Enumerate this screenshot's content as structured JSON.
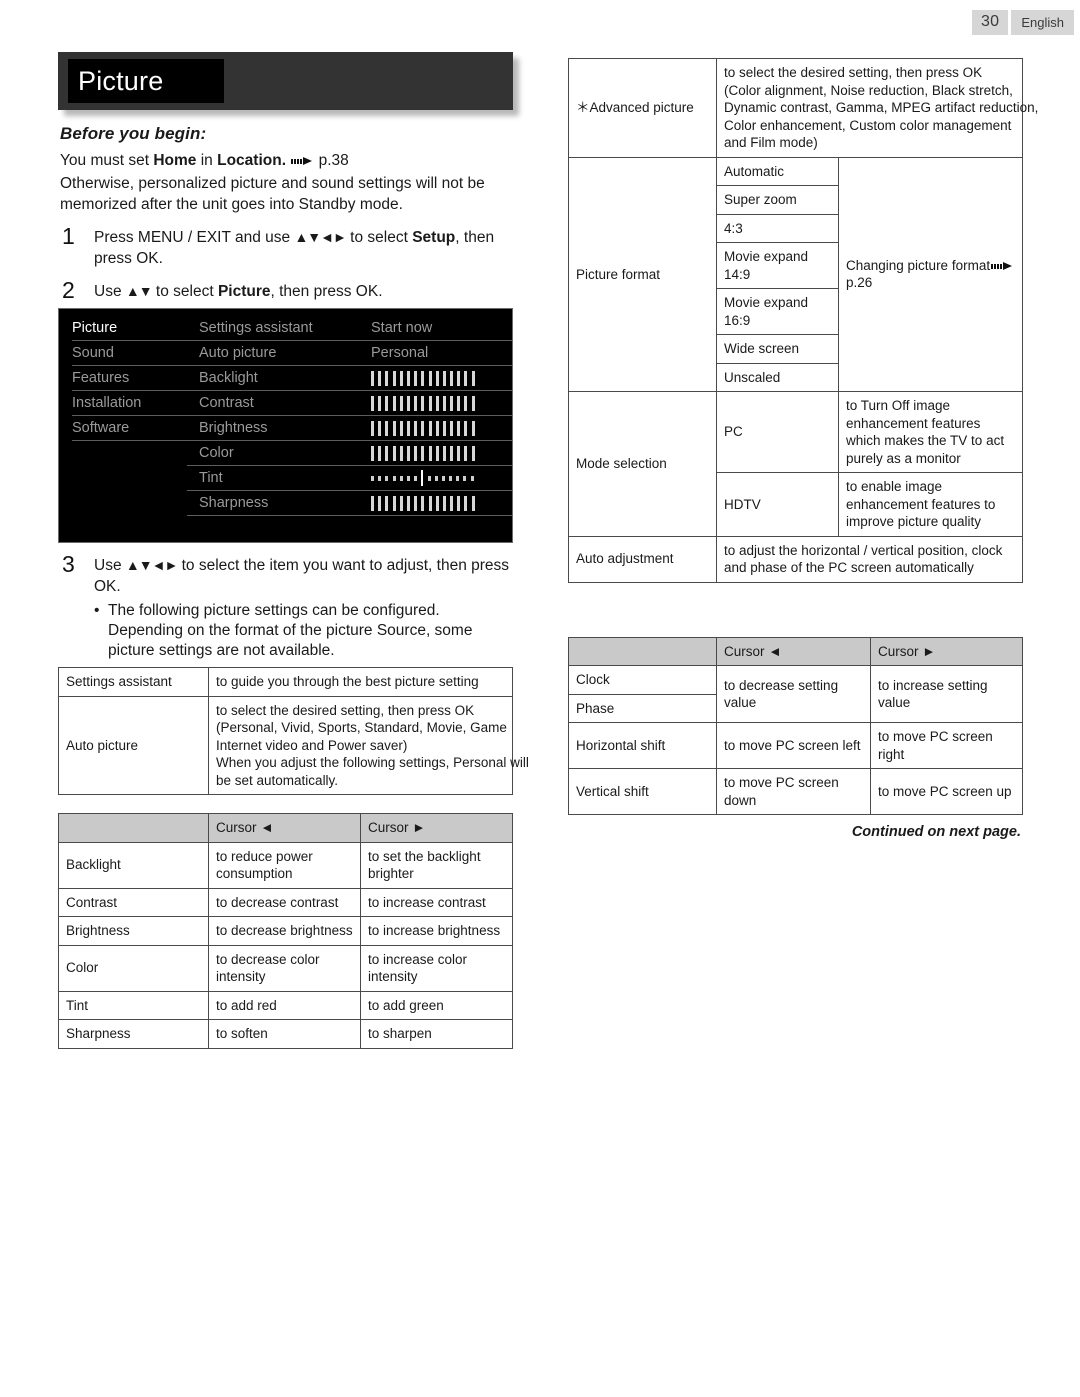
{
  "header": {
    "page_number": "30",
    "language": "English"
  },
  "section": {
    "title": "Picture",
    "before_you_begin_label": "Before you begin:",
    "requirement_prefix": "You must set ",
    "requirement_home": "Home",
    "requirement_mid": " in ",
    "requirement_location": "Location.",
    "requirement_page_ref": "p.38",
    "note": "Otherwise, personalized picture and sound settings will not be memorized after the unit goes into Standby mode."
  },
  "steps": [
    {
      "number": "1",
      "text_1": "Press MENU / EXIT and use ",
      "arrows": "▲▼◄►",
      "text_2": " to select ",
      "bold": "Setup",
      "text_3": ", then press OK."
    },
    {
      "number": "2",
      "text_1": "Use ",
      "arrows": "▲▼",
      "text_2": " to select ",
      "bold": "Picture",
      "text_3": ", then press OK."
    },
    {
      "number": "3",
      "text_1": "Use ",
      "arrows": "▲▼◄►",
      "text_2": " to select the item you want to adjust, then press OK.",
      "bullet": "The following picture settings can be configured. Depending on the format of the picture Source, some picture settings are not available."
    }
  ],
  "osd": {
    "menu_column": [
      {
        "label": "Picture",
        "selected": true
      },
      {
        "label": "Sound",
        "selected": false
      },
      {
        "label": "Features",
        "selected": false
      },
      {
        "label": "Installation",
        "selected": false
      },
      {
        "label": "Software",
        "selected": false
      }
    ],
    "settings_column": [
      "Settings assistant",
      "Auto picture",
      "Backlight",
      "Contrast",
      "Brightness",
      "Color",
      "Tint",
      "Sharpness"
    ],
    "values_column": [
      {
        "type": "text",
        "value": "Start now"
      },
      {
        "type": "text",
        "value": "Personal"
      },
      {
        "type": "bar",
        "ticks": 15,
        "marker": null
      },
      {
        "type": "bar",
        "ticks": 15,
        "marker": null
      },
      {
        "type": "bar",
        "ticks": 15,
        "marker": null
      },
      {
        "type": "bar",
        "ticks": 15,
        "marker": null
      },
      {
        "type": "bar-center",
        "ticks": 15,
        "marker": 8
      },
      {
        "type": "bar",
        "ticks": 15,
        "marker": null
      }
    ]
  },
  "table_settings": {
    "rows": [
      {
        "key": "Settings assistant",
        "desc_lines": [
          "to guide you through the best picture setting"
        ]
      },
      {
        "key": "Auto picture",
        "desc_lines": [
          "to select the desired setting, then press OK",
          "(Personal, Vivid, Sports, Standard, Movie, Game",
          "Internet video and Power saver)",
          "When you adjust the following settings, Personal will",
          "be set automatically."
        ]
      }
    ]
  },
  "table_cursor_left": {
    "headers": [
      "",
      "Cursor ◄",
      "Cursor ►"
    ],
    "rows": [
      {
        "key": "Backlight",
        "left": "to reduce power consumption",
        "right": "to set the backlight brighter"
      },
      {
        "key": "Contrast",
        "left": "to decrease contrast",
        "right": "to increase contrast"
      },
      {
        "key": "Brightness",
        "left": "to decrease brightness",
        "right": "to increase brightness"
      },
      {
        "key": "Color",
        "left": "to decrease color intensity",
        "right": "to increase color intensity"
      },
      {
        "key": "Tint",
        "left": "to add red",
        "right": "to add green"
      },
      {
        "key": "Sharpness",
        "left": "to soften",
        "right": "to sharpen"
      }
    ]
  },
  "table_advanced": {
    "advanced_picture": {
      "key": "＊Advanced picture",
      "desc_lines": [
        "to select the desired setting, then press OK",
        "(Color alignment, Noise reduction, Black stretch,",
        "Dynamic contrast, Gamma, MPEG artifact reduction,",
        "Color enhancement, Custom color management",
        "and Film mode)"
      ]
    },
    "picture_format": {
      "key": "Picture format",
      "options": [
        "Automatic",
        "Super zoom",
        "4:3",
        "Movie expand 14:9",
        "Movie expand 16:9",
        "Wide screen",
        "Unscaled"
      ],
      "note": "Changing picture format",
      "note_page_ref": "p.26"
    },
    "mode_selection": {
      "key": "Mode selection",
      "options": [
        {
          "name": "PC",
          "desc": "to Turn Off image enhancement features which makes the TV to act purely as a monitor"
        },
        {
          "name": "HDTV",
          "desc": "to enable image enhancement features to improve picture quality"
        }
      ]
    },
    "auto_adjustment": {
      "key": "Auto adjustment",
      "desc": "to adjust the horizontal / vertical position, clock and phase of the PC screen automatically"
    }
  },
  "table_cursor_right": {
    "headers": [
      "",
      "Cursor ◄",
      "Cursor ►"
    ],
    "rows": [
      {
        "key": "Clock"
      },
      {
        "key": "Phase"
      },
      {
        "key": "Horizontal shift",
        "left": "to move PC screen left",
        "right": "to move PC screen right"
      },
      {
        "key": "Vertical shift",
        "left": "to move PC screen down",
        "right": "to move PC screen up"
      }
    ],
    "merged_left": "to decrease setting value",
    "merged_right": "to increase setting value"
  },
  "footer": {
    "continued": "Continued on next page."
  }
}
